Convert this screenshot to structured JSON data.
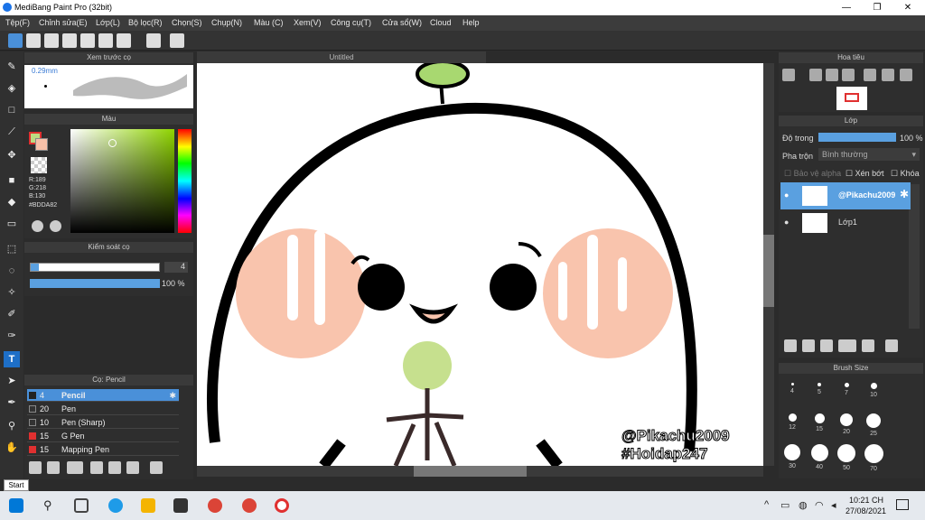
{
  "window": {
    "title": "MediBang Paint Pro (32bit)",
    "minimize": "—",
    "maximize": "❐",
    "close": "✕"
  },
  "menu": [
    "Tệp(F)",
    "Chỉnh sửa(E)",
    "Lớp(L)",
    "Bộ lọc(R)",
    "Chọn(S)",
    "Chụp(N)",
    "Màu (C)",
    "Xem(V)",
    "Công cụ(T)",
    "Cửa sổ(W)",
    "Cloud",
    "Help"
  ],
  "panels": {
    "preview": {
      "title": "Xem trước cọ",
      "size": "0.29mm"
    },
    "color": {
      "title": "Màu",
      "r": "R:189",
      "g": "G:218",
      "b": "B:130",
      "hex": "#BDDA82",
      "primary": "#bdda82",
      "secondary": "#f7c0a8"
    },
    "brushctl": {
      "title": "Kiểm soát cọ",
      "size": "4",
      "opacity": "100 %"
    },
    "brush": {
      "title": "Cọ: Pencil",
      "items": [
        {
          "num": "4",
          "label": "Pencil",
          "color": "#222222",
          "selected": true
        },
        {
          "num": "20",
          "label": "Pen",
          "color": "#333333"
        },
        {
          "num": "10",
          "label": "Pen (Sharp)",
          "color": "#333333"
        },
        {
          "num": "15",
          "label": "G Pen",
          "color": "#e03030"
        },
        {
          "num": "15",
          "label": "Mapping Pen",
          "color": "#e03030"
        }
      ]
    },
    "navigator": {
      "title": "Hoa tiêu"
    },
    "layer": {
      "title": "Lớp",
      "opacity_label": "Độ trong",
      "opacity_value": "100 %",
      "blend_label": "Pha trộn",
      "blend_value": "Bình thường",
      "protect_alpha": "Bảo vệ alpha",
      "clip": "Xén bớt",
      "lock": "Khóa",
      "layers": [
        {
          "name": "@Pikachu2009",
          "selected": true
        },
        {
          "name": "Lớp1",
          "selected": false
        }
      ]
    },
    "brushsize": {
      "title": "Brush Size",
      "sizes": [
        "4",
        "5",
        "7",
        "10",
        "12",
        "15",
        "20",
        "25",
        "30",
        "40",
        "50",
        "70"
      ]
    }
  },
  "canvas": {
    "tab": "Untitled",
    "watermark1": "@Pikachu2009",
    "watermark2": "#Hoidap247"
  },
  "tooltip": "Start",
  "taskbar": {
    "time": "10:21 CH",
    "date": "27/08/2021"
  }
}
